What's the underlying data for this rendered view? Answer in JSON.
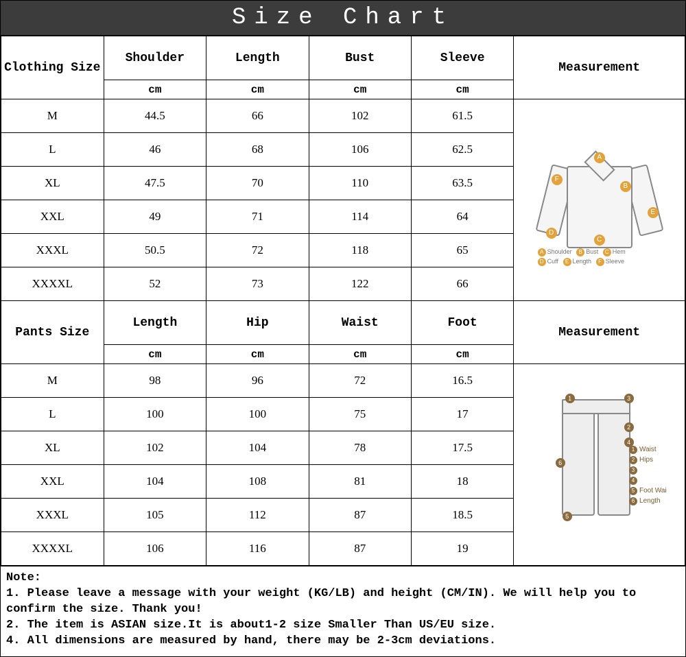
{
  "title": "Size  Chart",
  "clothing": {
    "size_label": "Clothing Size",
    "columns": [
      "Shoulder",
      "Length",
      "Bust",
      "Sleeve"
    ],
    "unit": "cm",
    "measurement_label": "Measurement",
    "rows": [
      {
        "size": "M",
        "vals": [
          "44.5",
          "66",
          "102",
          "61.5"
        ]
      },
      {
        "size": "L",
        "vals": [
          "46",
          "68",
          "106",
          "62.5"
        ]
      },
      {
        "size": "XL",
        "vals": [
          "47.5",
          "70",
          "110",
          "63.5"
        ]
      },
      {
        "size": "XXL",
        "vals": [
          "49",
          "71",
          "114",
          "64"
        ]
      },
      {
        "size": "XXXL",
        "vals": [
          "50.5",
          "72",
          "118",
          "65"
        ]
      },
      {
        "size": "XXXXL",
        "vals": [
          "52",
          "73",
          "122",
          "66"
        ]
      }
    ],
    "diagram_legend": [
      {
        "k": "A",
        "t": "Shoulder"
      },
      {
        "k": "B",
        "t": "Bust"
      },
      {
        "k": "C",
        "t": "Hem"
      },
      {
        "k": "D",
        "t": "Cuff"
      },
      {
        "k": "E",
        "t": "Length"
      },
      {
        "k": "F",
        "t": "Sleeve"
      }
    ]
  },
  "pants": {
    "size_label": "Pants Size",
    "columns": [
      "Length",
      "Hip",
      "Waist",
      "Foot"
    ],
    "unit": "cm",
    "measurement_label": "Measurement",
    "rows": [
      {
        "size": "M",
        "vals": [
          "98",
          "96",
          "72",
          "16.5"
        ]
      },
      {
        "size": "L",
        "vals": [
          "100",
          "100",
          "75",
          "17"
        ]
      },
      {
        "size": "XL",
        "vals": [
          "102",
          "104",
          "78",
          "17.5"
        ]
      },
      {
        "size": "XXL",
        "vals": [
          "104",
          "108",
          "81",
          "18"
        ]
      },
      {
        "size": "XXXL",
        "vals": [
          "105",
          "112",
          "87",
          "18.5"
        ]
      },
      {
        "size": "XXXXL",
        "vals": [
          "106",
          "116",
          "87",
          "19"
        ]
      }
    ],
    "diagram_legend": [
      {
        "k": "1",
        "t": "Waist"
      },
      {
        "k": "2",
        "t": "Hips"
      },
      {
        "k": "3",
        "t": ""
      },
      {
        "k": "4",
        "t": ""
      },
      {
        "k": "5",
        "t": "Foot Wai"
      },
      {
        "k": "6",
        "t": "Length"
      }
    ]
  },
  "note": {
    "heading": "Note:",
    "lines": [
      "1. Please leave a message with your weight (KG/LB) and height (CM/IN). We will help you to confirm the size. Thank you!",
      "2. The item is ASIAN size.It is about1-2 size Smaller Than US/EU size.",
      "4. All dimensions are measured by hand, there may be 2-3cm deviations."
    ]
  },
  "chart_data": [
    {
      "type": "table",
      "title": "Clothing Size",
      "columns": [
        "Size",
        "Shoulder (cm)",
        "Length (cm)",
        "Bust (cm)",
        "Sleeve (cm)"
      ],
      "rows": [
        [
          "M",
          44.5,
          66,
          102,
          61.5
        ],
        [
          "L",
          46,
          68,
          106,
          62.5
        ],
        [
          "XL",
          47.5,
          70,
          110,
          63.5
        ],
        [
          "XXL",
          49,
          71,
          114,
          64
        ],
        [
          "XXXL",
          50.5,
          72,
          118,
          65
        ],
        [
          "XXXXL",
          52,
          73,
          122,
          66
        ]
      ]
    },
    {
      "type": "table",
      "title": "Pants Size",
      "columns": [
        "Size",
        "Length (cm)",
        "Hip (cm)",
        "Waist (cm)",
        "Foot (cm)"
      ],
      "rows": [
        [
          "M",
          98,
          96,
          72,
          16.5
        ],
        [
          "L",
          100,
          100,
          75,
          17
        ],
        [
          "XL",
          102,
          104,
          78,
          17.5
        ],
        [
          "XXL",
          104,
          108,
          81,
          18
        ],
        [
          "XXXL",
          105,
          112,
          87,
          18.5
        ],
        [
          "XXXXL",
          106,
          116,
          87,
          19
        ]
      ]
    }
  ]
}
